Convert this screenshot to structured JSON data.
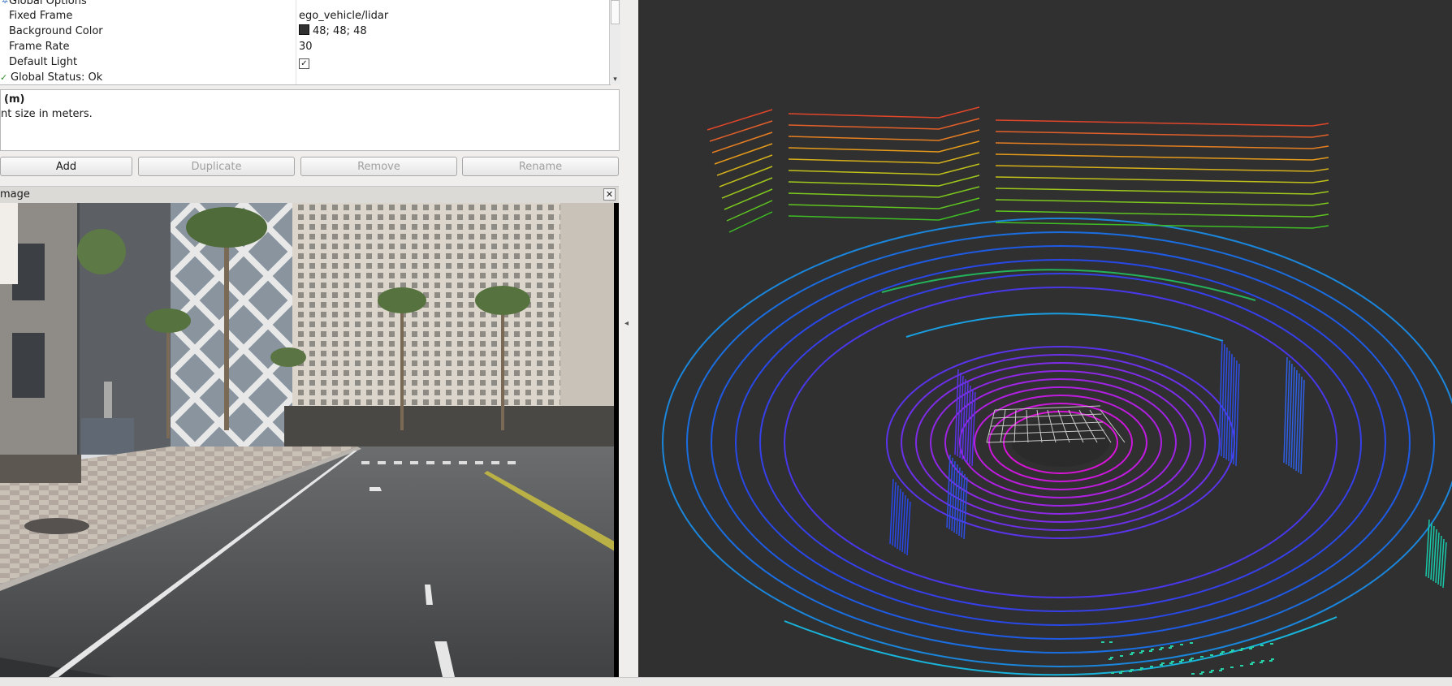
{
  "properties": {
    "rows": [
      {
        "name": "Global Options",
        "value": ""
      },
      {
        "name": "Fixed Frame",
        "value": "ego_vehicle/lidar"
      },
      {
        "name": "Background Color",
        "value": "48; 48; 48"
      },
      {
        "name": "Frame Rate",
        "value": "30"
      },
      {
        "name": "Default Light",
        "value": "✓"
      },
      {
        "name": "Global Status: Ok",
        "value": ""
      }
    ]
  },
  "description": {
    "title": " (m)",
    "text": "nt size in meters."
  },
  "buttons": {
    "add": "Add",
    "duplicate": "Duplicate",
    "remove": "Remove",
    "rename": "Rename"
  },
  "image_panel": {
    "title": "mage",
    "close": "✕"
  },
  "viewport": {
    "background_color": "#303030"
  },
  "icons": {
    "collapse_left": "◂",
    "scroll_down": "▾",
    "global_options": "gear-icon",
    "status_ok": "check-icon"
  }
}
